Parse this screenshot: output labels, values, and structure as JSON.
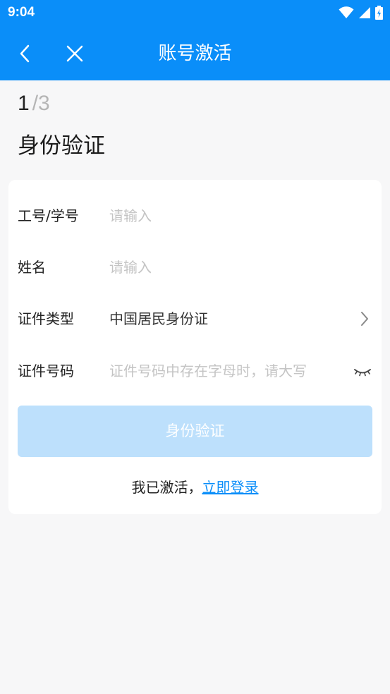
{
  "status_bar": {
    "time": "9:04"
  },
  "app_bar": {
    "title": "账号激活"
  },
  "progress": {
    "current": "1",
    "total": "/3"
  },
  "page": {
    "title": "身份验证"
  },
  "form": {
    "staff_id": {
      "label": "工号/学号",
      "placeholder": "请输入"
    },
    "name": {
      "label": "姓名",
      "placeholder": "请输入"
    },
    "id_type": {
      "label": "证件类型",
      "value": "中国居民身份证"
    },
    "id_number": {
      "label": "证件号码",
      "placeholder": "证件号码中存在字母时，请大写"
    }
  },
  "submit": {
    "label": "身份验证"
  },
  "footer": {
    "text": "我已激活，",
    "link": "立即登录"
  },
  "colors": {
    "primary": "#0a8ef9",
    "button_disabled": "#bde0fc",
    "background": "#f7f7f8"
  },
  "icons": {
    "back": "chevron-left-icon",
    "close": "close-icon",
    "select": "chevron-right-icon",
    "visibility": "eye-closed-icon"
  }
}
